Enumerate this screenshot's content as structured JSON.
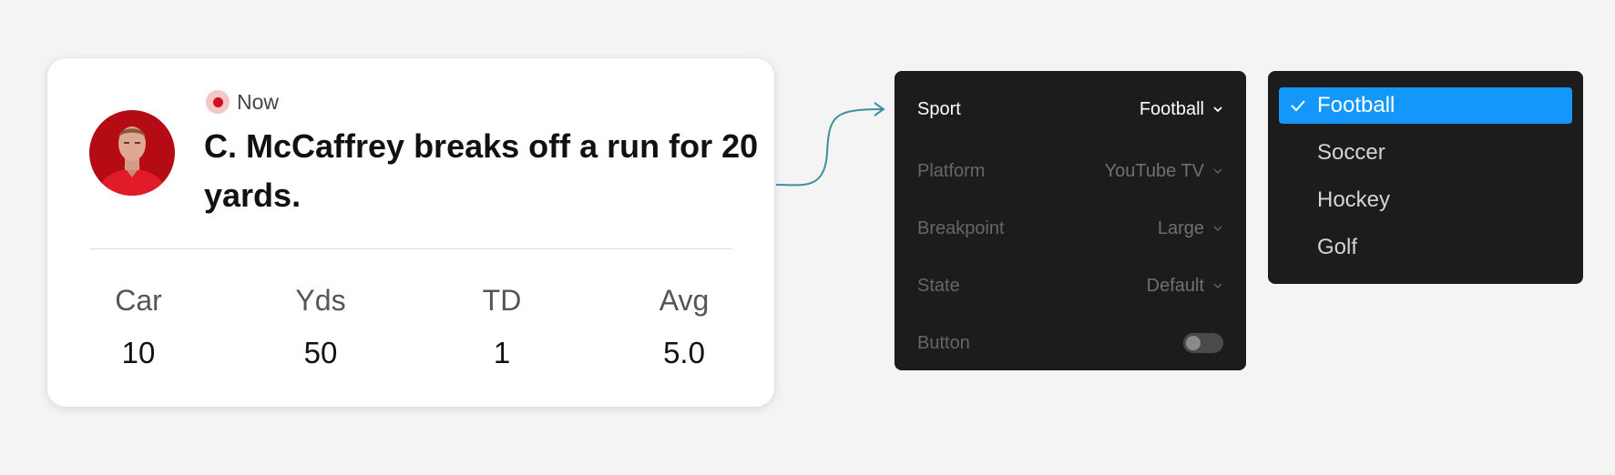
{
  "card": {
    "live_label": "Now",
    "headline": "C. McCaffrey breaks off a run for 20 yards.",
    "stats": [
      {
        "label": "Car",
        "value": "10"
      },
      {
        "label": "Yds",
        "value": "50"
      },
      {
        "label": "TD",
        "value": "1"
      },
      {
        "label": "Avg",
        "value": "5.0"
      }
    ]
  },
  "controls": {
    "rows": [
      {
        "label": "Sport",
        "value": "Football",
        "active": true
      },
      {
        "label": "Platform",
        "value": "YouTube TV",
        "active": false
      },
      {
        "label": "Breakpoint",
        "value": "Large",
        "active": false
      },
      {
        "label": "State",
        "value": "Default",
        "active": false
      }
    ],
    "toggle": {
      "label": "Button",
      "on": false
    }
  },
  "menu": {
    "items": [
      "Football",
      "Soccer",
      "Hockey",
      "Golf"
    ],
    "selected": "Football"
  },
  "colors": {
    "live_red": "#d40f1c",
    "accent_blue": "#1497fb",
    "connector_teal": "#3e8ea0",
    "panel_bg": "#1c1c1c"
  }
}
